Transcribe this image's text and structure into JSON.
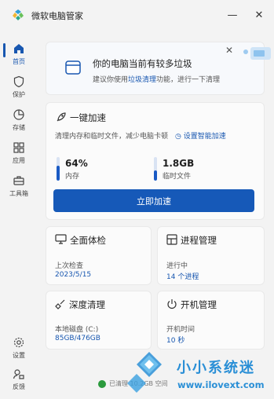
{
  "app": {
    "title": "微软电脑管家"
  },
  "window_controls": {
    "minimize": "—",
    "close": "✕"
  },
  "sidebar": {
    "items": [
      {
        "label": "首页",
        "icon": "home-icon",
        "active": true
      },
      {
        "label": "保护",
        "icon": "shield-icon"
      },
      {
        "label": "存储",
        "icon": "pie-icon"
      },
      {
        "label": "应用",
        "icon": "apps-icon"
      },
      {
        "label": "工具箱",
        "icon": "toolbox-icon"
      }
    ],
    "bottom": [
      {
        "label": "设置",
        "icon": "gear-icon"
      },
      {
        "label": "反馈",
        "icon": "feedback-icon"
      }
    ]
  },
  "banner": {
    "title": "你的电脑当前有较多垃圾",
    "sub_prefix": "建议你使用",
    "sub_link": "垃圾清理",
    "sub_suffix": "功能，进行一下清理"
  },
  "speedup": {
    "title": "一键加速",
    "desc": "清理内存和临时文件，减少电脑卡顿",
    "smart_link": "设置智能加速",
    "memory": {
      "value": "64%",
      "label": "内存",
      "level": 0.64
    },
    "temp": {
      "value": "1.8GB",
      "label": "临时文件",
      "level": 0.45
    },
    "button": "立即加速"
  },
  "checkup": {
    "title": "全面体检",
    "sub": "上次检查",
    "value": "2023/5/15"
  },
  "process": {
    "title": "进程管理",
    "sub": "进行中",
    "value": "14 个进程"
  },
  "cleanup": {
    "title": "深度清理",
    "sub": "本地磁盘 (C:)",
    "value": "85GB/476GB"
  },
  "boot": {
    "title": "开机管理",
    "sub": "开机时间",
    "value": "10 秒"
  },
  "footer": {
    "status": "已清理 10.2GB 空间"
  },
  "watermark": {
    "line1": "小小系统迷",
    "line2": "www.ilovext.com"
  },
  "colors": {
    "accent": "#1659b8",
    "background": "#f3f3f3",
    "card": "#fbfbfb"
  }
}
